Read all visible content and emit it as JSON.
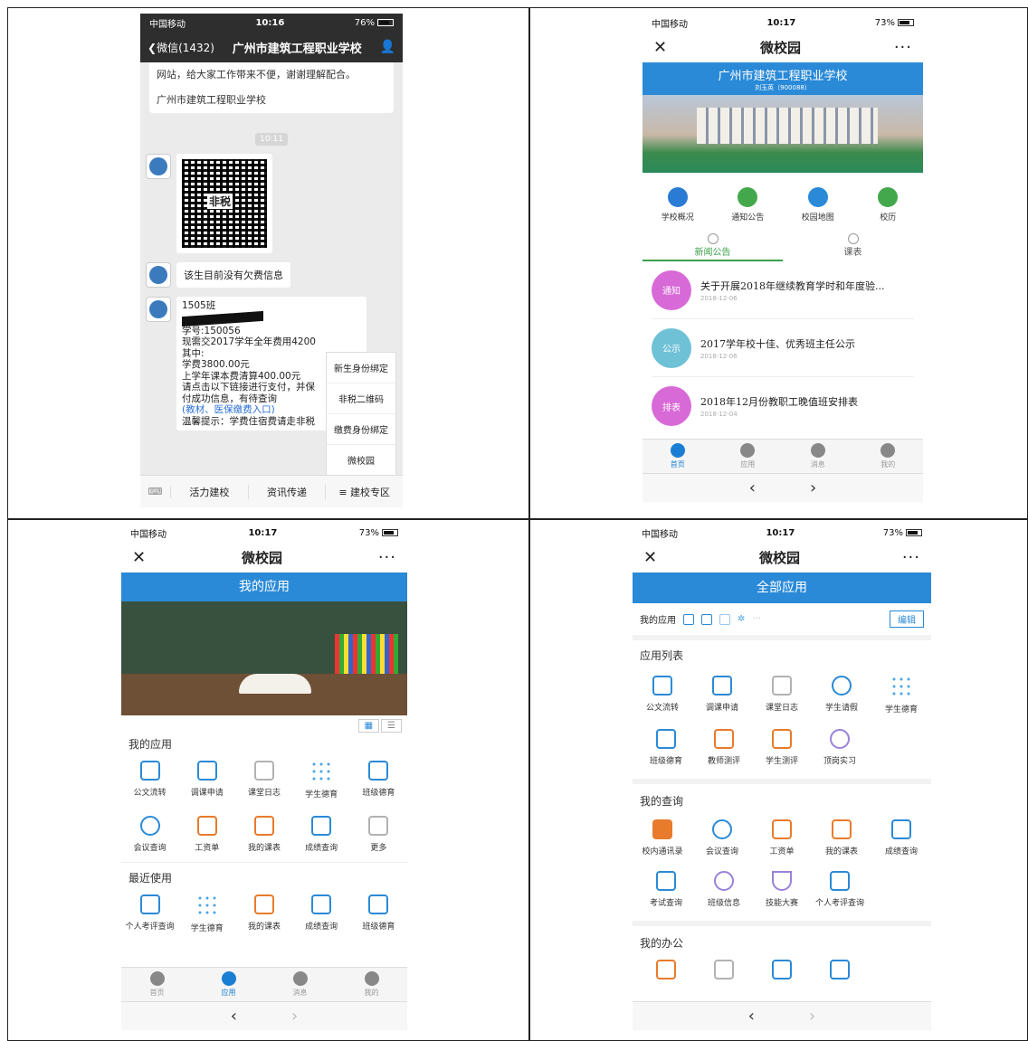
{
  "p1": {
    "status": {
      "carrier": "中国移动",
      "time": "10:16",
      "battery": "76%"
    },
    "nav": {
      "back": "微信(1432)",
      "title": "广州市建筑工程职业学校"
    },
    "card_top": {
      "lines": [
        "网站，给大家工作带来不便，谢谢理解配合。",
        "广州市建筑工程职业学校"
      ]
    },
    "timestamp": "10:11",
    "qr_watermark": "非税",
    "bubble_no_fee": "该生目前没有欠费信息",
    "fee_lines": [
      "1505班",
      "学号:150056",
      "现需交2017学年全年费用4200",
      "其中:",
      "学费3800.00元",
      "上学年课本费清算400.00元",
      "请点击以下链接进行支付，并保",
      "付成功信息，有待查询"
    ],
    "fee_link": "(教材、医保缴费入口)",
    "fee_tip": "温馨提示：学费住宿费请走非税",
    "popup_menu": [
      "新生身份绑定",
      "非税二维码",
      "缴费身份绑定",
      "微校园"
    ],
    "bottom_menu": [
      "活力建校",
      "资讯传递",
      "≡ 建校专区"
    ]
  },
  "p2": {
    "status": {
      "carrier": "中国移动",
      "time": "10:17",
      "battery": "73%"
    },
    "nav": {
      "close": "✕",
      "title": "微校园",
      "more": "···"
    },
    "banner": {
      "school": "广州市建筑工程职业学校",
      "user": "刘玉英（900088）"
    },
    "quick": [
      "学校概况",
      "通知公告",
      "校园地图",
      "校历"
    ],
    "tabs": [
      "新闻公告",
      "课表"
    ],
    "news": [
      {
        "tag": "通知",
        "title": "关于开展2018年继续教育学时和年度验...",
        "date": "2018-12-06",
        "color": "#d86ad8"
      },
      {
        "tag": "公示",
        "title": "2017学年校十佳、优秀班主任公示",
        "date": "2018-12-06",
        "color": "#6fc1d6"
      },
      {
        "tag": "排表",
        "title": "2018年12月份教职工晚值班安排表",
        "date": "2018-12-04",
        "color": "#d86ad8"
      }
    ],
    "tabbar": [
      "首页",
      "应用",
      "消息",
      "我的"
    ]
  },
  "p3": {
    "status": {
      "carrier": "中国移动",
      "time": "10:17",
      "battery": "73%"
    },
    "nav": {
      "close": "✕",
      "title": "微校园",
      "more": "···"
    },
    "header": "我的应用",
    "section1": "我的应用",
    "apps1": [
      "公文流转",
      "调课申请",
      "课堂日志",
      "学生德育",
      "班级德育"
    ],
    "apps2": [
      "会议查询",
      "工资单",
      "我的课表",
      "成绩查询",
      "更多"
    ],
    "section2": "最近使用",
    "apps3": [
      "个人考评查询",
      "学生德育",
      "我的课表",
      "成绩查询",
      "班级德育"
    ],
    "tabbar": [
      "首页",
      "应用",
      "消息",
      "我的"
    ]
  },
  "p4": {
    "status": {
      "carrier": "中国移动",
      "time": "10:17",
      "battery": "73%"
    },
    "nav": {
      "close": "✕",
      "title": "微校园",
      "more": "···"
    },
    "header": "全部应用",
    "my_apps": "我的应用",
    "edit": "编辑",
    "sec_list": "应用列表",
    "list1": [
      "公文流转",
      "调课申请",
      "课堂日志",
      "学生请假",
      "学生德育"
    ],
    "list2": [
      "班级德育",
      "教师测评",
      "学生测评",
      "顶岗实习"
    ],
    "sec_query": "我的查询",
    "query1": [
      "校内通讯录",
      "会议查询",
      "工资单",
      "我的课表",
      "成绩查询"
    ],
    "query2": [
      "考试查询",
      "班级信息",
      "技能大赛",
      "个人考评查询"
    ],
    "sec_office": "我的办公"
  }
}
